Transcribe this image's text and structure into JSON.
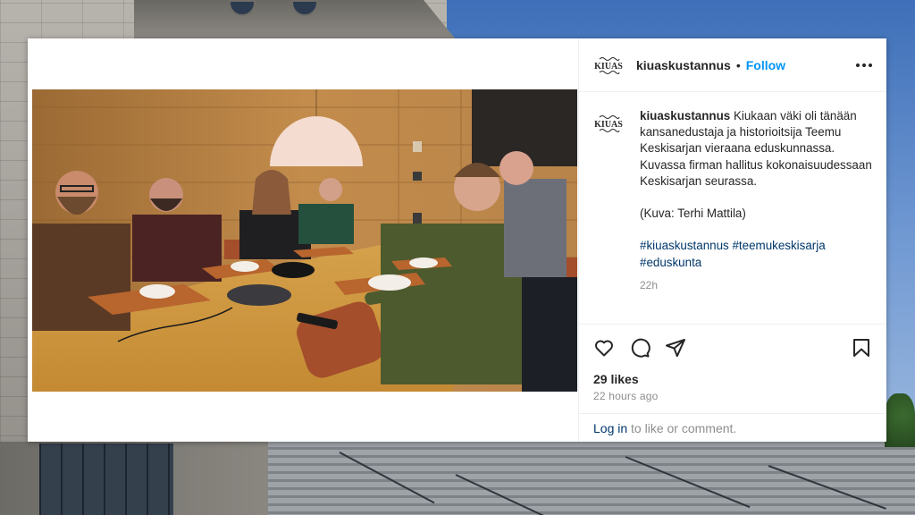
{
  "post": {
    "username": "kiuaskustannus",
    "avatar_text": "KIUAS",
    "follow_label": "Follow",
    "dot_separator": "•",
    "caption": "Kiukaan väki oli tänään kansanedustaja ja historioitsija Teemu Keskisarjan vieraana eduskunnassa. Kuvassa firman hallitus kokonaisuudessaan Keskisarjan seurassa.\n\n(Kuva: Terhi Mattila)",
    "hashtags": [
      "#kiuaskustannus",
      "#teemukeskisarja",
      "#eduskunta"
    ],
    "caption_time": "22h",
    "likes": "29 likes",
    "timestamp": "22 hours ago",
    "comment_login": "Log in",
    "comment_rest": " to like or comment."
  },
  "colors": {
    "accent": "#0095f6",
    "hashtag": "#00376b",
    "muted": "#8e8e8e",
    "text": "#262626"
  },
  "icons": {
    "heart": "heart-icon",
    "comment": "comment-icon",
    "share": "share-icon",
    "save": "bookmark-icon",
    "more": "more-options-icon"
  }
}
